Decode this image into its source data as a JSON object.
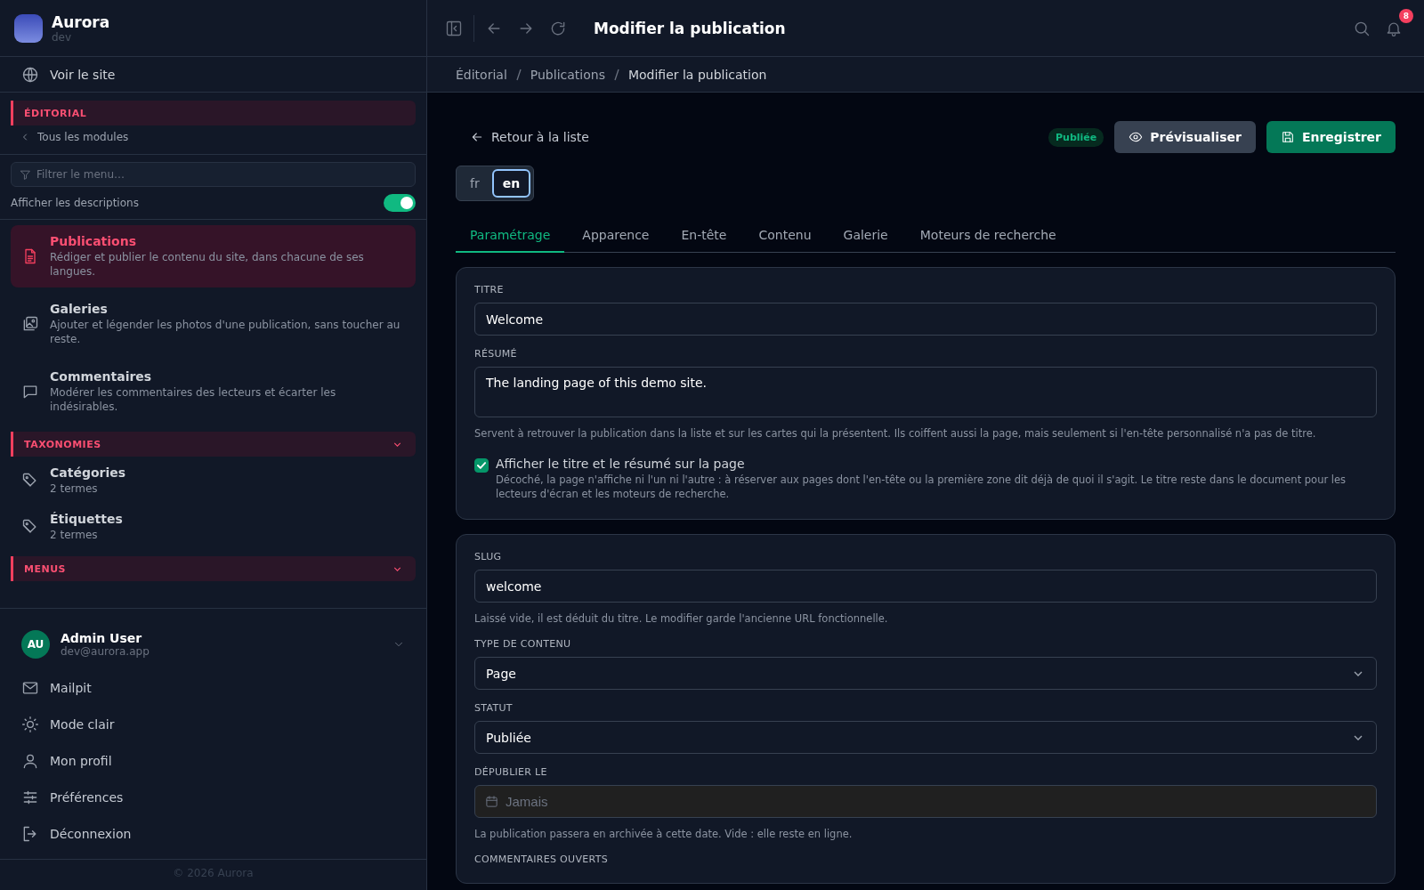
{
  "app": {
    "name": "Aurora",
    "env": "dev"
  },
  "sidebar": {
    "view_site": "Voir le site",
    "module": {
      "title": "ÉDITORIAL",
      "back_link": "Tous les modules"
    },
    "filter": {
      "placeholder": "Filtrer le menu…"
    },
    "descriptions_toggle": {
      "label": "Afficher les descriptions",
      "on": true
    },
    "items": [
      {
        "label": "Publications",
        "description": "Rédiger et publier le contenu du site, dans chacune de ses langues.",
        "selected": true
      },
      {
        "label": "Galeries",
        "description": "Ajouter et légender les photos d'une publication, sans toucher au reste.",
        "selected": false
      },
      {
        "label": "Commentaires",
        "description": "Modérer les commentaires des lecteurs et écarter les indésirables.",
        "selected": false
      }
    ],
    "groups": [
      {
        "title": "TAXONOMIES",
        "expanded": true,
        "items": [
          {
            "label": "Catégories",
            "description": "2 termes",
            "selected": false
          },
          {
            "label": "Étiquettes",
            "description": "2 termes",
            "selected": false
          }
        ]
      },
      {
        "title": "MENUS",
        "expanded": true
      }
    ],
    "user": {
      "initials": "AU",
      "name": "Admin User",
      "email": "dev@aurora.app"
    },
    "user_menu": [
      "Mailpit",
      "Mode clair",
      "Mon profil",
      "Préférences",
      "Déconnexion"
    ],
    "copyright": "© 2026 Aurora"
  },
  "toolbar": {
    "title": "Modifier la publication",
    "notifications": "8"
  },
  "breadcrumb": [
    "Éditorial",
    "Publications",
    "Modifier la publication"
  ],
  "back_link": "Retour à la liste",
  "status_badge": "Publiée",
  "buttons": {
    "preview": "Prévisualiser",
    "save": "Enregistrer"
  },
  "languages": [
    {
      "label": "fr",
      "selected": false
    },
    {
      "label": "en",
      "selected": true
    }
  ],
  "tabs": [
    {
      "label": "Paramétrage",
      "selected": true
    },
    {
      "label": "Apparence",
      "selected": false
    },
    {
      "label": "En-tête",
      "selected": false
    },
    {
      "label": "Contenu",
      "selected": false
    },
    {
      "label": "Galerie",
      "selected": false
    },
    {
      "label": "Moteurs de recherche",
      "selected": false
    }
  ],
  "cards": [
    {
      "fields": [
        {
          "kind": "text",
          "label": "TITRE",
          "value": "Welcome"
        },
        {
          "kind": "textarea",
          "label": "RÉSUMÉ",
          "value": "The landing page of this demo site.",
          "help": "Servent à retrouver la publication dans la liste et sur les cartes qui la présentent. Ils coiffent aussi la page, mais seulement si l'en-tête personnalisé n'a pas de titre."
        },
        {
          "kind": "checkbox",
          "label": "Afficher le titre et le résumé sur la page",
          "checked": true,
          "help": "Décoché, la page n'affiche ni l'un ni l'autre : à réserver aux pages dont l'en-tête ou la première zone dit déjà de quoi il s'agit. Le titre reste dans le document pour les lecteurs d'écran et les moteurs de recherche."
        }
      ]
    },
    {
      "fields": [
        {
          "kind": "text",
          "label": "SLUG",
          "value": "welcome",
          "help": "Laissé vide, il est déduit du titre. Le modifier garde l'ancienne URL fonctionnelle."
        },
        {
          "kind": "select",
          "label": "TYPE DE CONTENU",
          "value": "Page"
        },
        {
          "kind": "select",
          "label": "STATUT",
          "value": "Publiée"
        },
        {
          "kind": "date",
          "label": "DÉPUBLIER LE",
          "placeholder": "Jamais",
          "help": "La publication passera en archivée à cette date. Vide : elle reste en ligne."
        },
        {
          "kind": "label",
          "label": "COMMENTAIRES OUVERTS"
        }
      ]
    }
  ]
}
